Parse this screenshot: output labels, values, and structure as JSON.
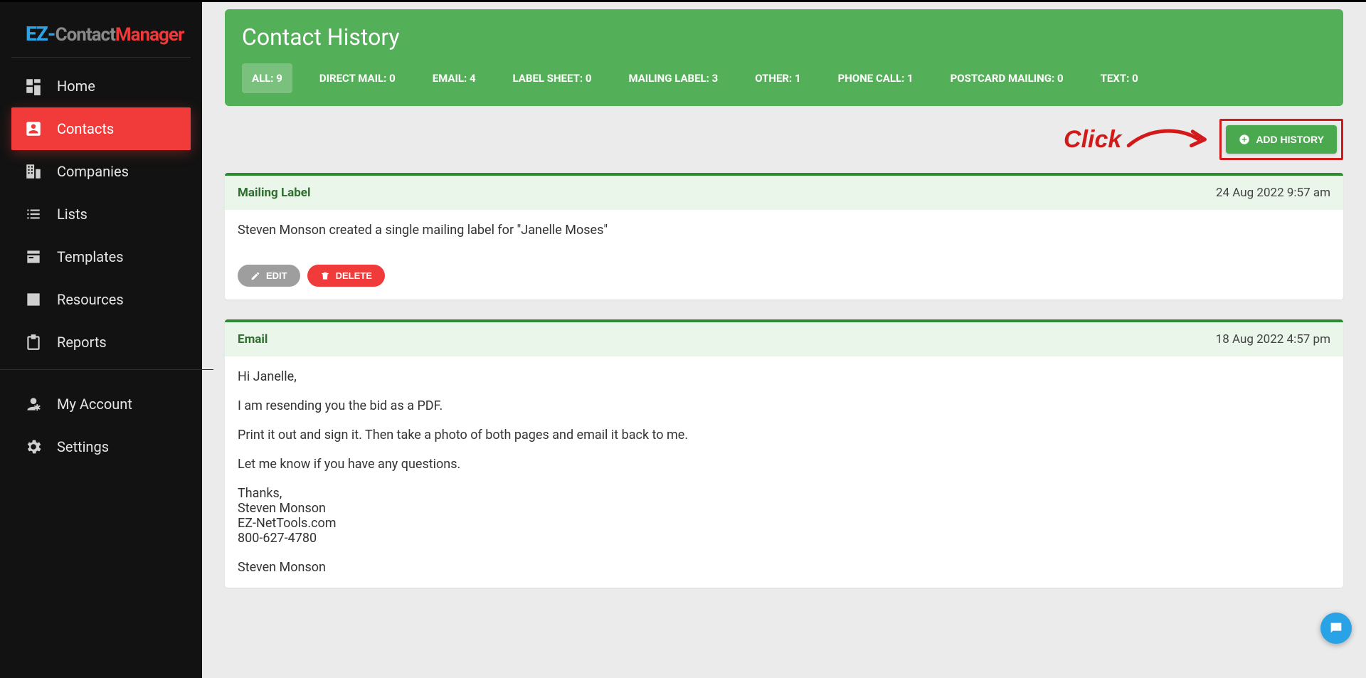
{
  "logo": {
    "part1": "EZ-",
    "part2": "Contact",
    "part3": "Manager"
  },
  "sidebar": {
    "items": [
      {
        "label": "Home"
      },
      {
        "label": "Contacts"
      },
      {
        "label": "Companies"
      },
      {
        "label": "Lists"
      },
      {
        "label": "Templates"
      },
      {
        "label": "Resources"
      },
      {
        "label": "Reports"
      },
      {
        "label": "My Account"
      },
      {
        "label": "Settings"
      }
    ]
  },
  "page": {
    "title": "Contact History",
    "tabs": {
      "all": "ALL: 9",
      "direct_mail": "DIRECT MAIL: 0",
      "email": "EMAIL: 4",
      "label_sheet": "LABEL SHEET: 0",
      "mailing_label": "MAILING LABEL: 3",
      "other": "OTHER: 1",
      "phone_call": "PHONE CALL: 1",
      "postcard": "POSTCARD MAILING: 0",
      "text": "TEXT: 0"
    },
    "callout_text": "Click",
    "add_button": "ADD HISTORY"
  },
  "buttons": {
    "edit": "EDIT",
    "delete": "DELETE"
  },
  "history": [
    {
      "type": "Mailing Label",
      "date": "24 Aug 2022 9:57 am",
      "body": "Steven Monson created a single mailing label for \"Janelle Moses\""
    },
    {
      "type": "Email",
      "date": "18 Aug 2022 4:57 pm",
      "lines": [
        "Hi Janelle,",
        "I am resending you the bid as a PDF.",
        "Print it out and sign it.  Then take a photo of both pages and email it back to me.",
        "Let me know if you have any questions.",
        "Thanks,",
        "Steven Monson",
        "EZ-NetTools.com",
        "800-627-4780",
        "Steven Monson"
      ]
    }
  ]
}
